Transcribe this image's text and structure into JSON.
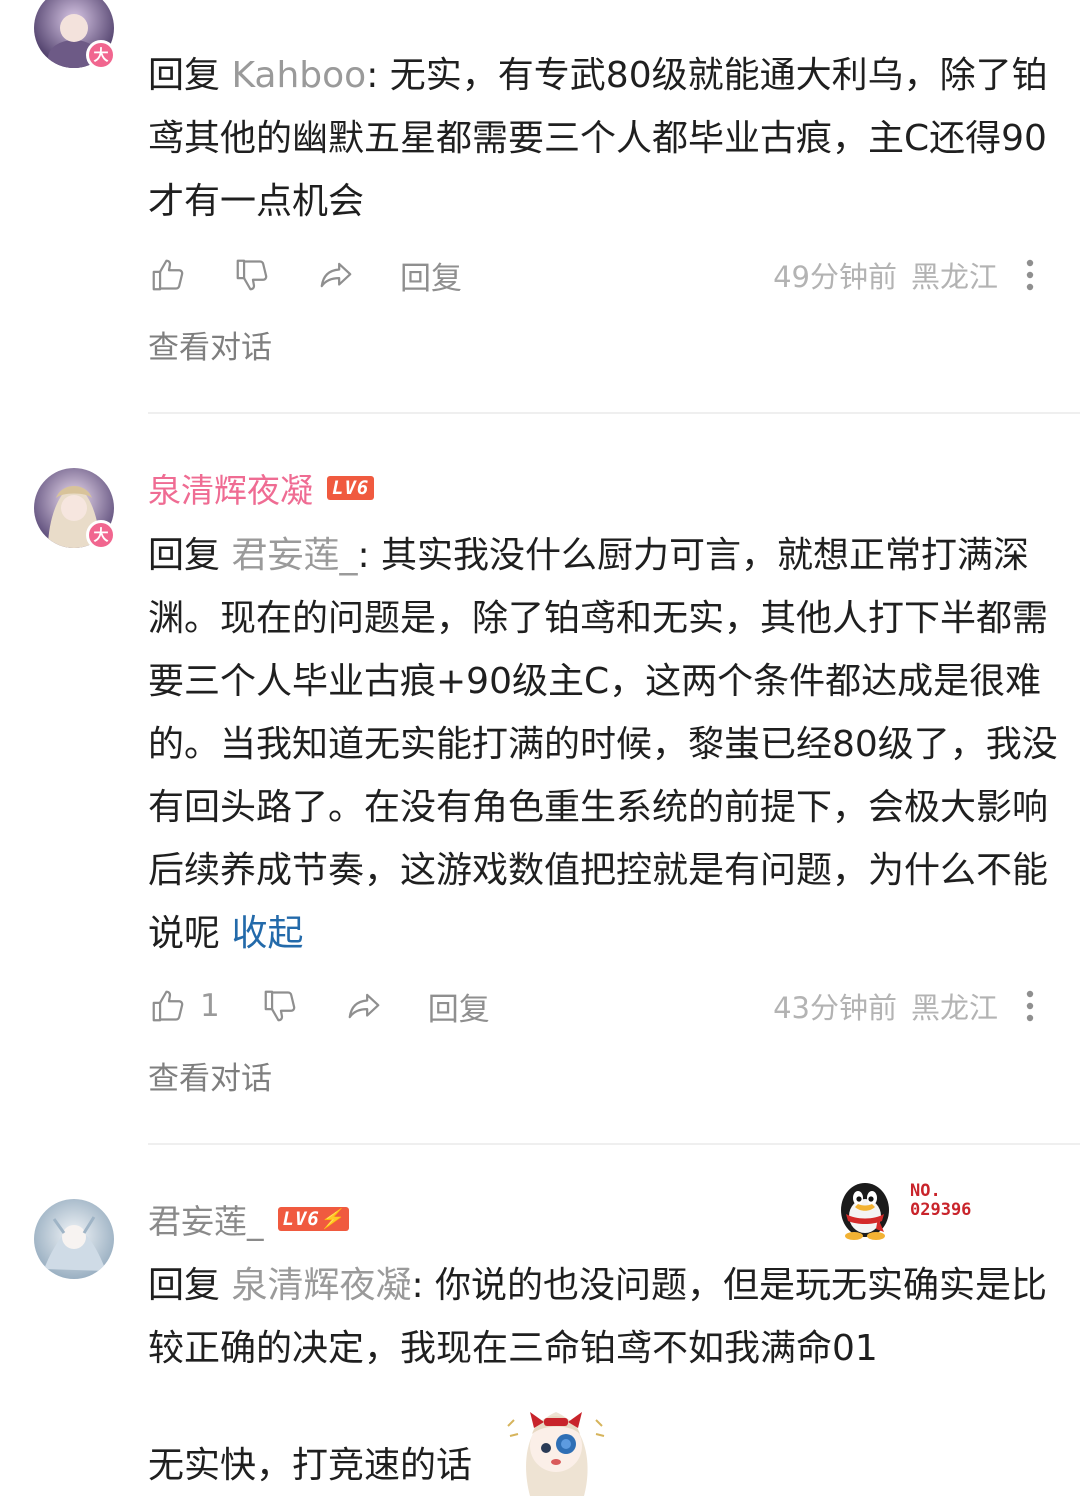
{
  "comments": [
    {
      "avatar_badge": "大",
      "body": {
        "prefix": "回复 ",
        "target": "Kahboo",
        "text": ": 无实，有专武80级就能通大利乌，除了铂鸢其他的幽默五星都需要三个人都毕业古痕，主C还得90才有一点机会"
      },
      "actions": {
        "reply_label": "回复",
        "time": "49分钟前",
        "location": "黑龙江"
      },
      "view_conversation": "查看对话"
    },
    {
      "username": "泉清辉夜凝",
      "level": "LV6",
      "avatar_badge": "大",
      "body": {
        "prefix": "回复 ",
        "target": "君妄莲_",
        "text": ": 其实我没什么厨力可言，就想正常打满深渊。现在的问题是，除了铂鸢和无实，其他人打下半都需要三个人毕业古痕+90级主C，这两个条件都达成是很难的。当我知道无实能打满的时候，黎蚩已经80级了，我没有回头路了。在没有角色重生系统的前提下，会极大影响后续养成节奏，这游戏数值把控就是有问题，为什么不能说呢",
        "collapse": " 收起"
      },
      "actions": {
        "like_count": "1",
        "reply_label": "回复",
        "time": "43分钟前",
        "location": "黑龙江"
      },
      "view_conversation": "查看对话"
    },
    {
      "username": "君妄莲_",
      "level": "LV6⚡",
      "fan_badge_number": "NO.\n029396",
      "body": {
        "prefix": "回复 ",
        "target": "泉清辉夜凝",
        "text": ": 你说的也没问题，但是玩无实确实是比较正确的决定，我现在三命铂鸢不如我满命01",
        "line2": "无实快，打竞速的话"
      }
    }
  ],
  "colors": {
    "username_pink": "#ef6c93",
    "link_blue": "#236aaa",
    "level_red": "#f05a3f",
    "meta_grey": "#b3b3b3"
  },
  "icons": [
    "thumbs-up-icon",
    "thumbs-down-icon",
    "share-icon",
    "more-vertical-icon",
    "qq-penguin-icon"
  ]
}
